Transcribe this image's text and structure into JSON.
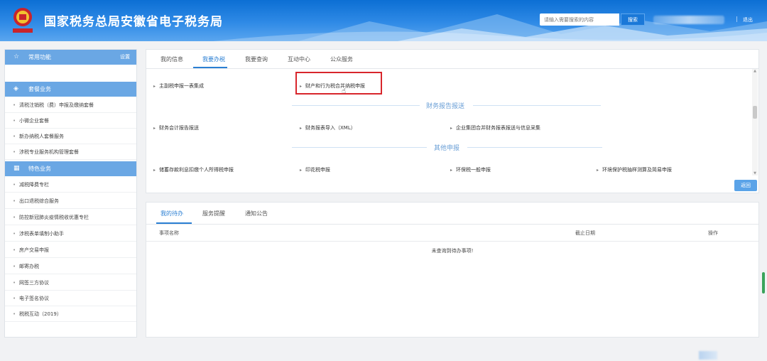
{
  "header": {
    "title": "国家税务总局安徽省电子税务局",
    "search_placeholder": "请输入需要搜索的内容",
    "search_button": "搜索",
    "separator": "|",
    "logout": "退出",
    "colors": {
      "primary": "#0c6fd4",
      "light": "#5aa6ef"
    }
  },
  "sidebar": {
    "common": {
      "icon": "star-icon",
      "label": "常用功能",
      "settings": "设置"
    },
    "package": {
      "icon": "layers-icon",
      "label": "套餐业务",
      "items": [
        "清税注销税（费）申报及缴纳套餐",
        "小微企业套餐",
        "新办纳税人套餐服务",
        "涉税专业服务机构管理套餐"
      ]
    },
    "special": {
      "icon": "grid-icon",
      "label": "特色业务",
      "items": [
        "减税降费专栏",
        "出口退税综合服务",
        "防控新冠肺炎疫情税收优惠专栏",
        "涉税表单填制小助手",
        "房产交易申报",
        "邮寄办税",
        "网签三方协议",
        "电子签名协议",
        "税税互动（2019）"
      ]
    }
  },
  "main": {
    "tabs": [
      "我的信息",
      "我要办税",
      "我要查询",
      "互动中心",
      "公众服务"
    ],
    "active_tab": "我要办税",
    "row1": [
      "主副税申报一表集成",
      "财产和行为税合并纳税申报"
    ],
    "section_financial": "财务报告报送",
    "row2": [
      "财务会计报告报送",
      "财务报表导入（XML）",
      "企业集团合并财务报表报送与信息采集"
    ],
    "section_other": "其他申报",
    "row3": [
      "储蓄存款利息扣缴个人所得税申报",
      "印花税申报",
      "环保税一般申报",
      "环境保护税抽样测算及简易申报"
    ],
    "back_button": "返回",
    "highlight_color": "#d8262c"
  },
  "bottom": {
    "tabs": [
      "我的待办",
      "服务提醒",
      "通知公告"
    ],
    "active_tab": "我的待办",
    "columns": [
      "事项名称",
      "截止日期",
      "操作"
    ],
    "empty_message": "未查询到待办事项!"
  }
}
